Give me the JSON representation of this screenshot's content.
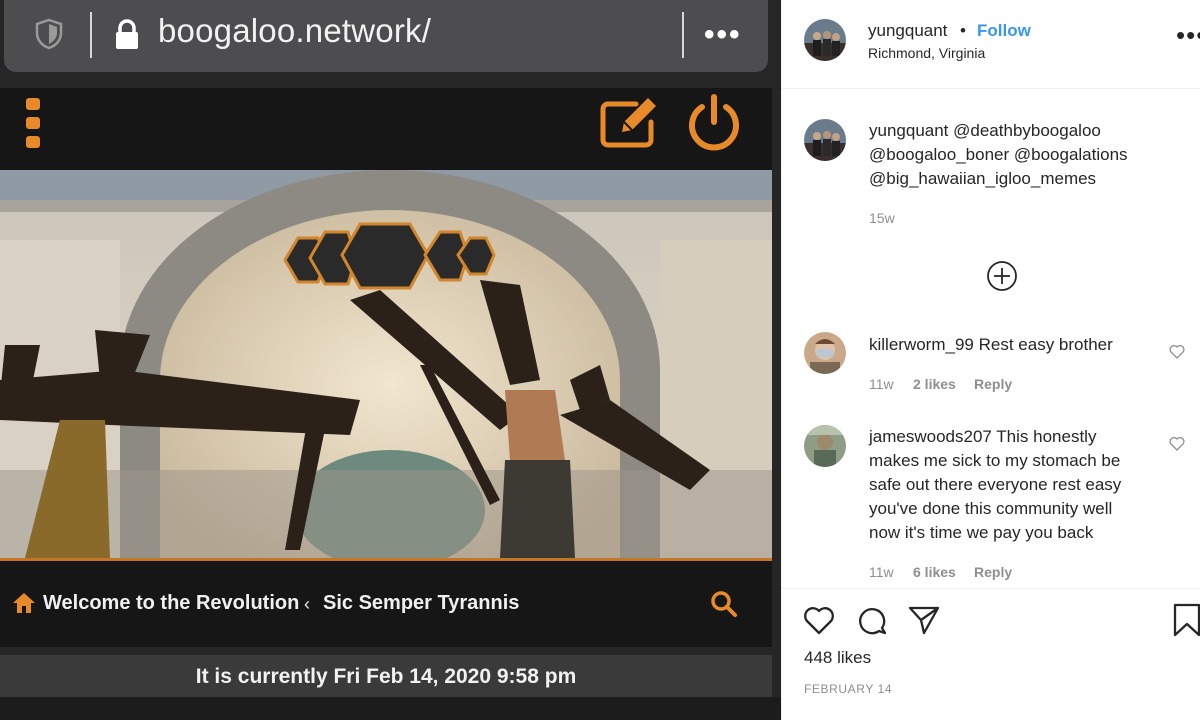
{
  "browser": {
    "url": "boogaloo.network/"
  },
  "forum": {
    "breadcrumbs": [
      "Welcome to the Revolution",
      "Sic Semper Tyrannis"
    ],
    "breadcrumb_separator": "‹",
    "current_time": "It is currently Fri Feb 14, 2020 9:58 pm"
  },
  "instagram": {
    "username": "yungquant",
    "separator": "•",
    "follow_label": "Follow",
    "location": "Richmond, Virginia",
    "caption": {
      "username": "yungquant",
      "lines": [
        "@deathbyboogaloo",
        "@boogaloo_boner @boogalations",
        "@big_hawaiian_igloo_memes"
      ],
      "age": "15w"
    },
    "comments": [
      {
        "username": "killerworm_99",
        "lines": [
          "Rest easy brother"
        ],
        "age": "11w",
        "likes": "2 likes",
        "reply_label": "Reply"
      },
      {
        "username": "jameswoods207",
        "lines": [
          "This honestly",
          "makes me sick to my stomach be",
          "safe out there everyone rest easy",
          "you've done this community well",
          "now it's time we pay you back"
        ],
        "age": "11w",
        "likes": "6 likes",
        "reply_label": "Reply"
      }
    ],
    "likes_count": "448 likes",
    "post_date": "FEBRUARY 14"
  },
  "icons": {
    "shield": "shield-icon",
    "lock": "lock-icon",
    "more": "more-dots-icon",
    "menu": "vertical-dots-menu-icon",
    "edit": "edit-pencil-icon",
    "power": "power-icon",
    "home": "home-icon",
    "search": "search-icon",
    "add_comments": "plus-circle-icon",
    "like": "heart-icon",
    "comment": "comment-icon",
    "share": "paper-plane-icon",
    "save": "bookmark-icon"
  },
  "colors": {
    "forum_accent": "#e88a2a",
    "instagram_link": "#3897f0",
    "forum_background": "#161616"
  }
}
